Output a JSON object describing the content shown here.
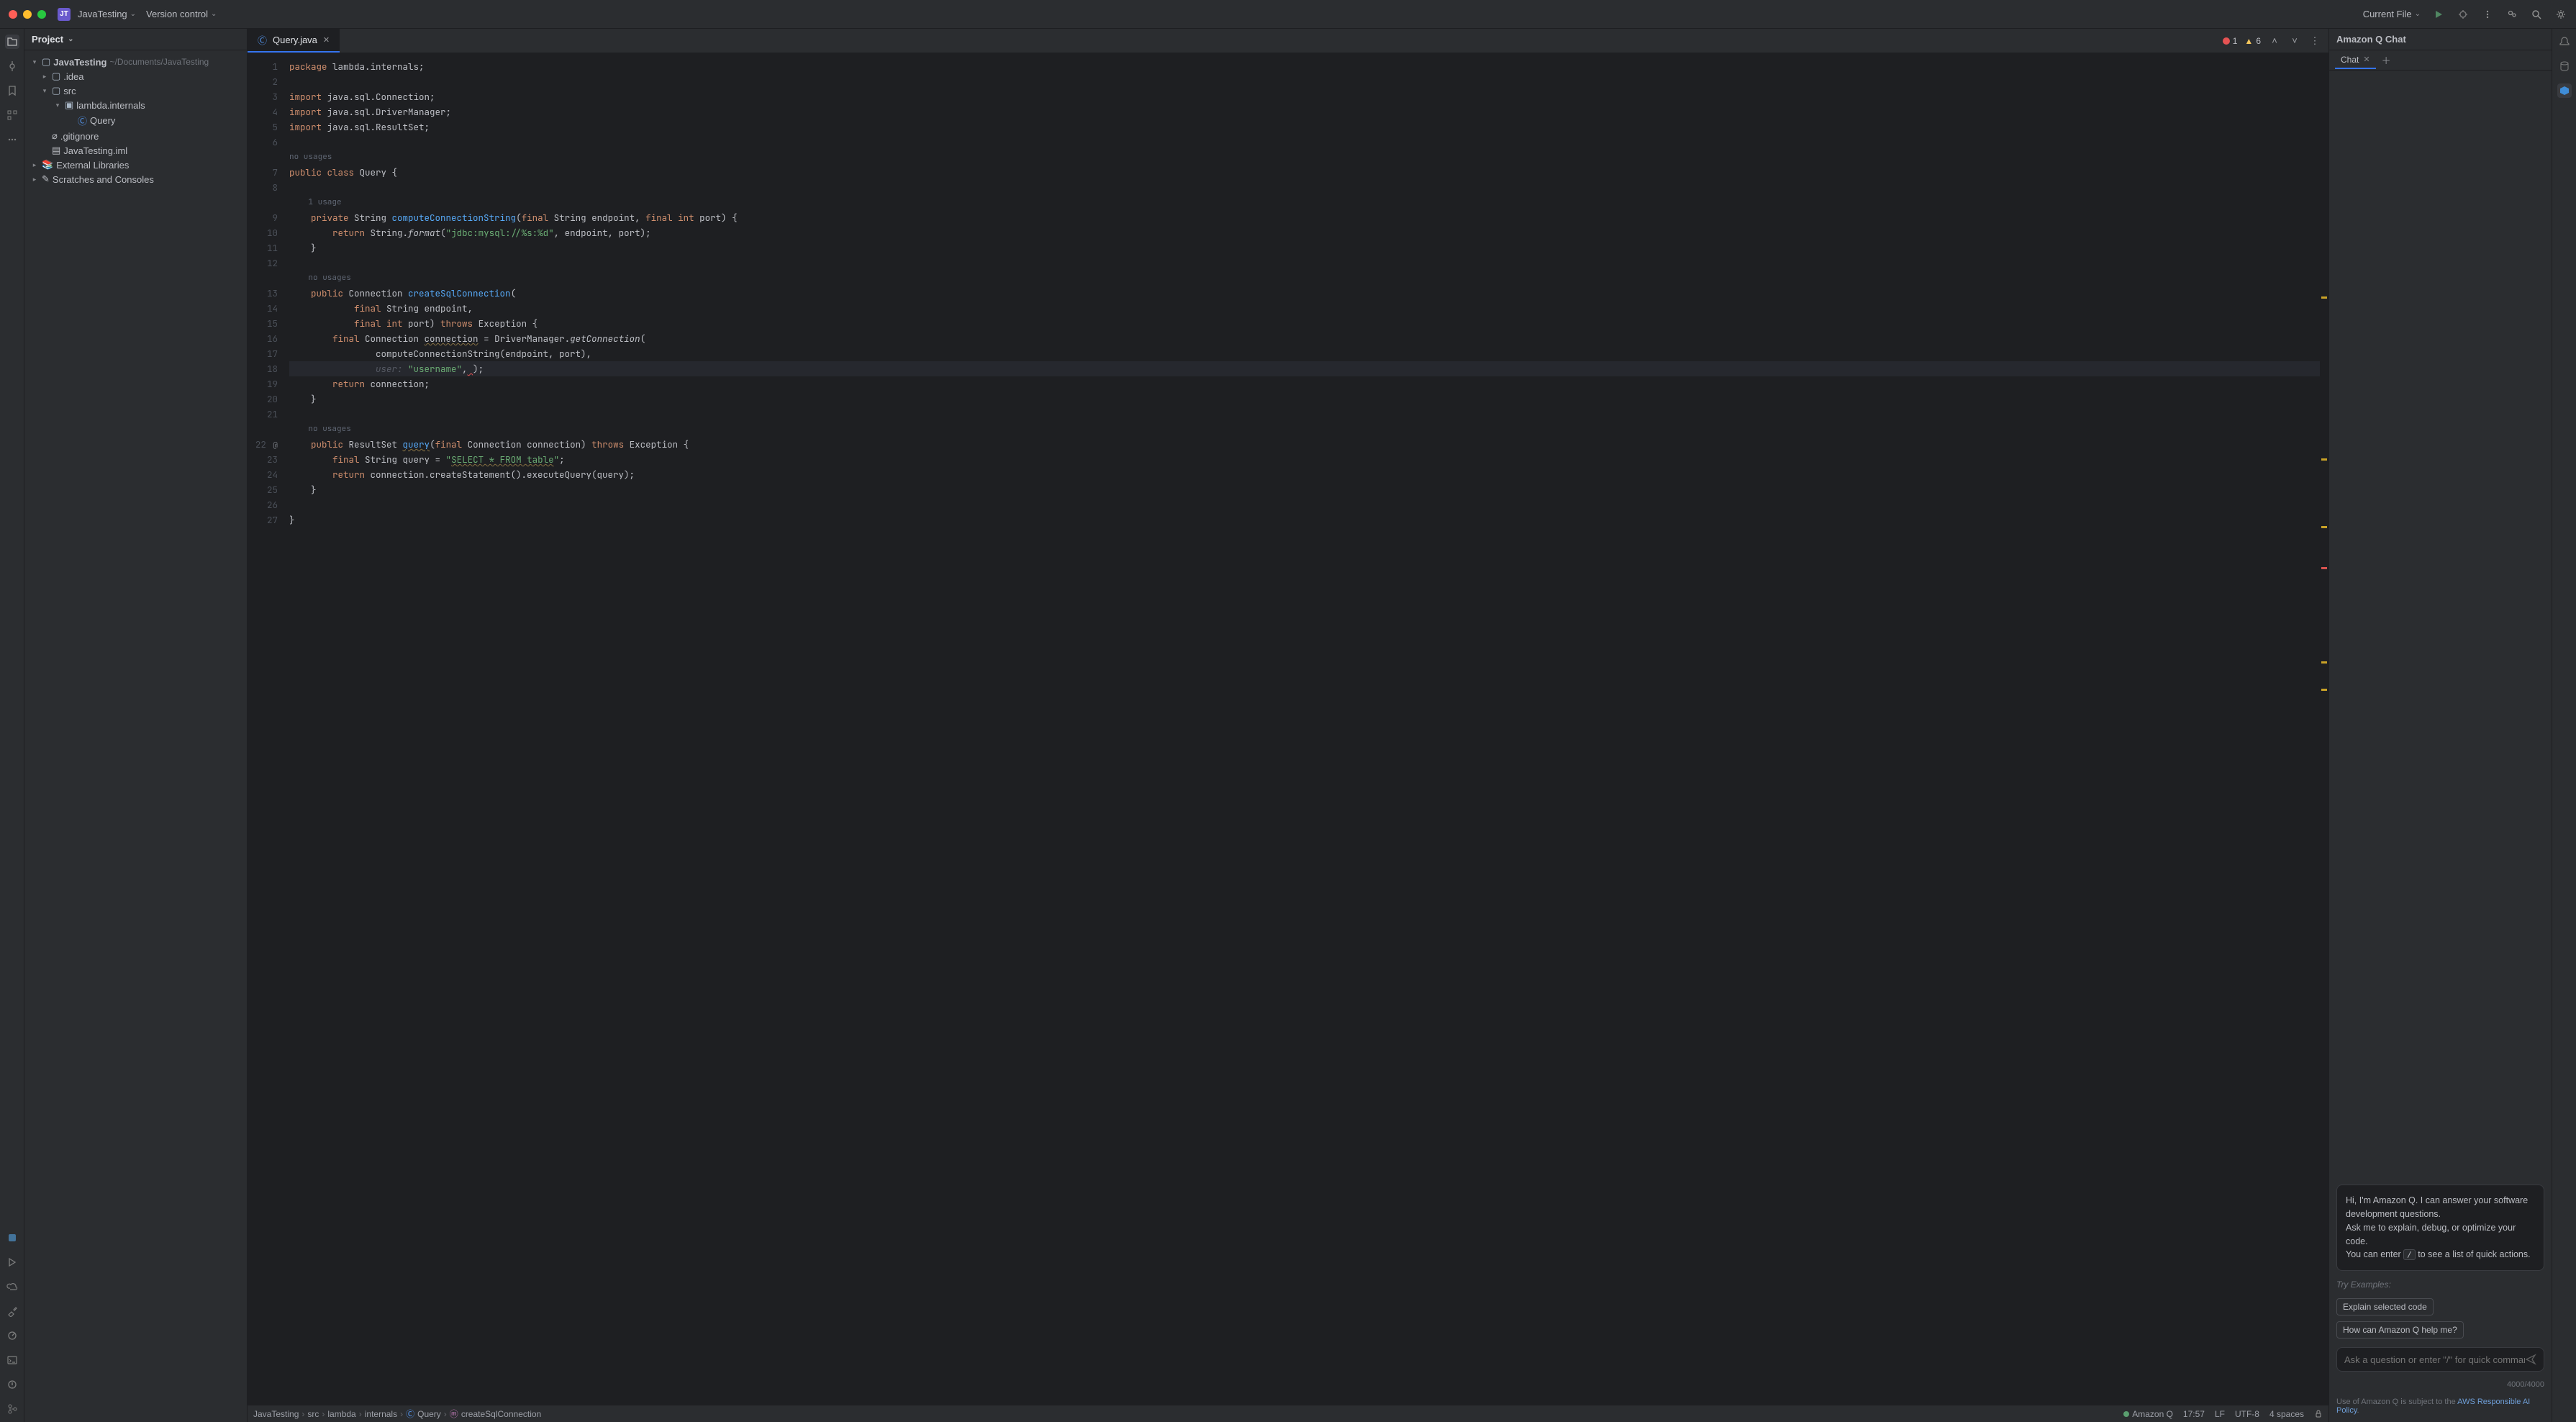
{
  "titlebar": {
    "project_badge": "JT",
    "project_name": "JavaTesting",
    "vcs_label": "Version control",
    "run_config": "Current File"
  },
  "project_panel": {
    "title": "Project",
    "root": "JavaTesting",
    "root_path": "~/Documents/JavaTesting",
    "nodes": {
      "idea": ".idea",
      "src": "src",
      "pkg": "lambda.internals",
      "query": "Query",
      "gitignore": ".gitignore",
      "iml": "JavaTesting.iml",
      "ext_libs": "External Libraries",
      "scratches": "Scratches and Consoles"
    }
  },
  "tab": {
    "filename": "Query.java",
    "error_count": "1",
    "warn_count": "6"
  },
  "code": {
    "l1": "package lambda.internals;",
    "l2": "",
    "l3": "import java.sql.Connection;",
    "l4": "import java.sql.DriverManager;",
    "l5": "import java.sql.ResultSet;",
    "l6": "",
    "hint_no_usages": "no usages",
    "l7": "public class Query {",
    "l8": "",
    "hint_1_usage": "    1 usage",
    "l9": "    private String computeConnectionString(final String endpoint, final int port) {",
    "l10": "        return String.format(\"jdbc:mysql://%s:%d\", endpoint, port);",
    "l11": "    }",
    "l12": "",
    "hint13": "    no usages",
    "l13": "    public Connection createSqlConnection(",
    "l14": "            final String endpoint,",
    "l15": "            final int port) throws Exception {",
    "l16": "        final Connection connection = DriverManager.getConnection(",
    "l17": "                computeConnectionString(endpoint, port),",
    "l18_ghost": "                user: ",
    "l18_rest": "\"username\", );",
    "l19": "        return connection;",
    "l20": "    }",
    "l21": "",
    "hint22": "    no usages",
    "l22": "    public ResultSet query(final Connection connection) throws Exception {",
    "l23": "        final String query = \"SELECT * FROM table\";",
    "l24": "        return connection.createStatement().executeQuery(query);",
    "l25": "    }",
    "l26": "",
    "l27": "}"
  },
  "line_numbers": [
    "1",
    "2",
    "3",
    "4",
    "5",
    "6",
    "",
    "7",
    "8",
    "",
    "9",
    "10",
    "11",
    "12",
    "",
    "13",
    "14",
    "15",
    "16",
    "17",
    "18",
    "19",
    "20",
    "21",
    "",
    "22",
    "23",
    "24",
    "25",
    "26",
    "27"
  ],
  "chat": {
    "title": "Amazon Q Chat",
    "tab_label": "Chat",
    "greeting_1": "Hi, I'm Amazon Q. I can answer your software development questions.",
    "greeting_2": "Ask me to explain, debug, or optimize your code.",
    "greeting_3a": "You can enter ",
    "greeting_3_key": "/",
    "greeting_3b": " to see a list of quick actions.",
    "try_label": "Try Examples:",
    "chip1": "Explain selected code",
    "chip2": "How can Amazon Q help me?",
    "placeholder": "Ask a question or enter \"/\" for quick commands",
    "counter": "4000/4000",
    "policy_prefix": "Use of Amazon Q is subject to the ",
    "policy_link": "AWS Responsible AI Policy",
    "policy_suffix": "."
  },
  "breadcrumb": {
    "p1": "JavaTesting",
    "p2": "src",
    "p3": "lambda",
    "p4": "internals",
    "p5": "Query",
    "p6": "createSqlConnection",
    "amazonq": "Amazon Q",
    "pos": "17:57",
    "le": "LF",
    "enc": "UTF-8",
    "indent": "4 spaces"
  },
  "icons": {
    "chevron_down": "⌄",
    "chevron_right": "›"
  }
}
